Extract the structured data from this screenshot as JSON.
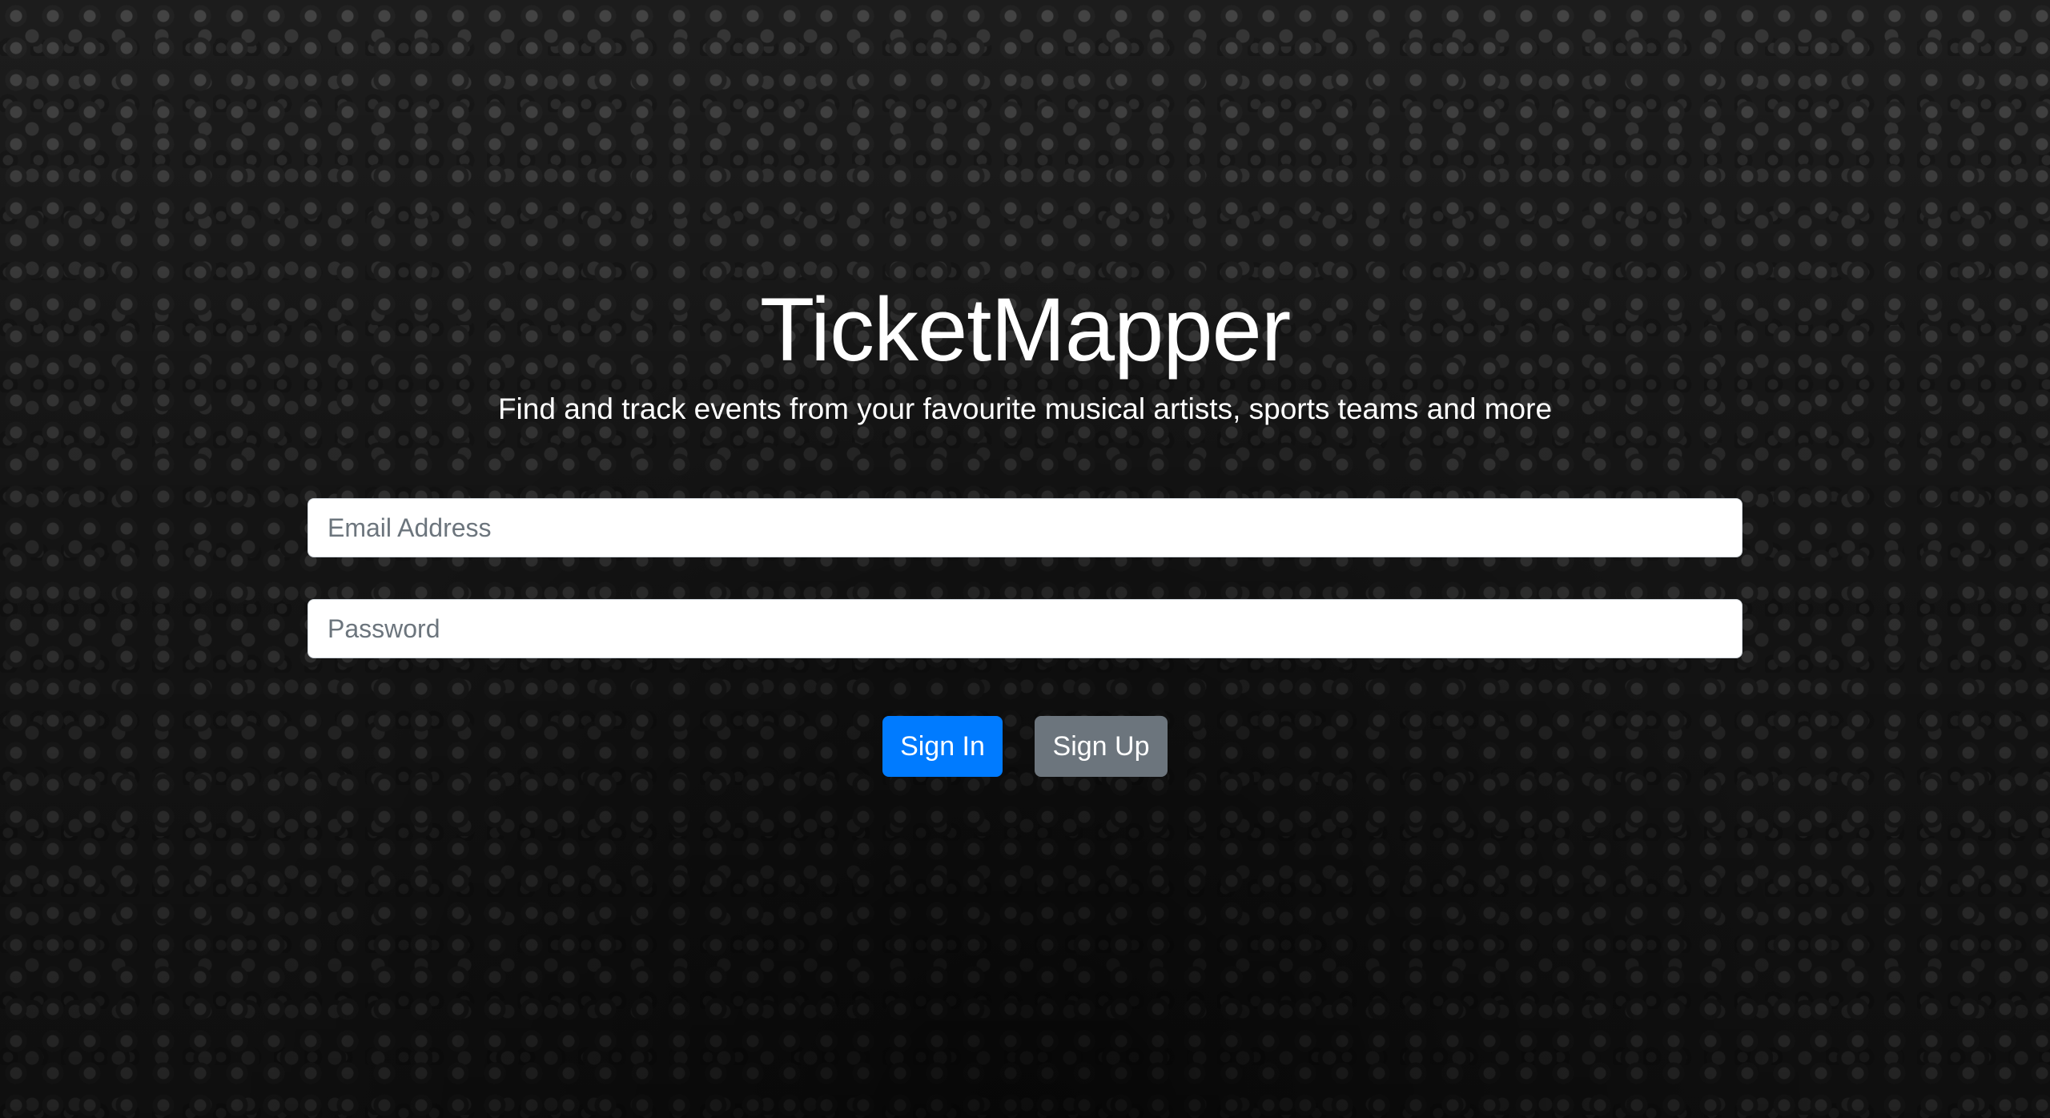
{
  "app": {
    "title": "TicketMapper",
    "subtitle": "Find and track events from your favourite musical artists, sports teams and more"
  },
  "form": {
    "email_placeholder": "Email Address",
    "email_value": "",
    "password_placeholder": "Password",
    "password_value": "",
    "signin_label": "Sign In",
    "signup_label": "Sign Up"
  },
  "colors": {
    "primary": "#007bff",
    "secondary": "#6c757d",
    "text": "#ffffff",
    "input_placeholder": "#6c757d"
  },
  "background": {
    "description_icon": "crowd-photo"
  }
}
